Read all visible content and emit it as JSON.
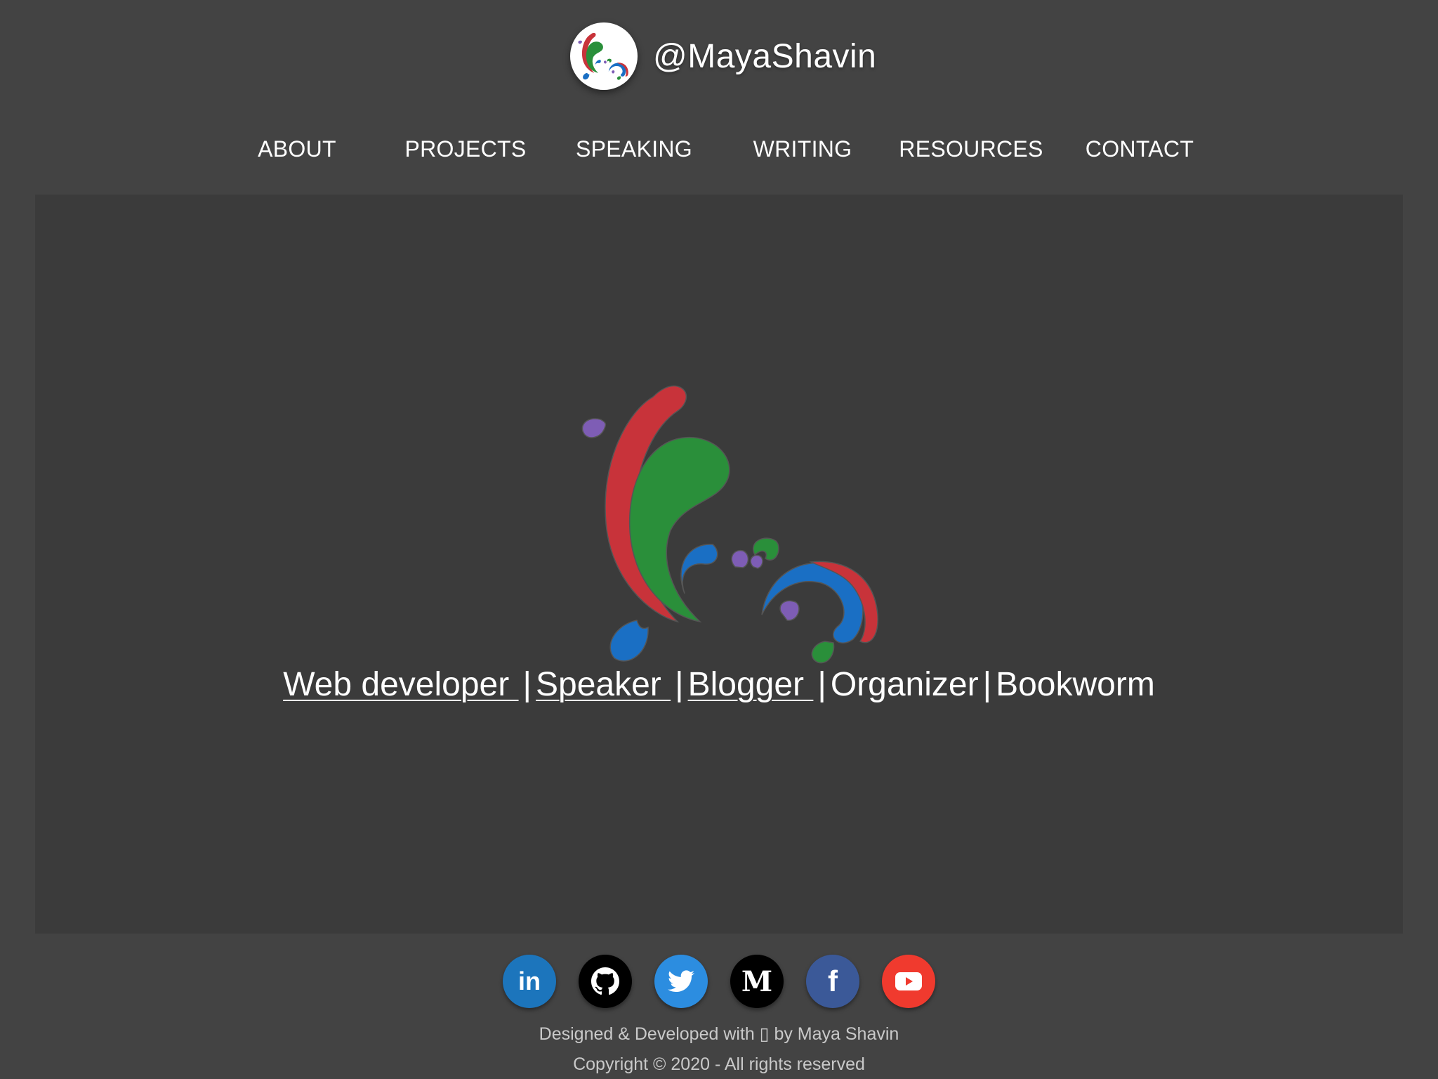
{
  "header": {
    "handle": "@MayaShavin"
  },
  "nav": {
    "items": [
      {
        "label": "About"
      },
      {
        "label": "Projects"
      },
      {
        "label": "Speaking"
      },
      {
        "label": "Writing"
      },
      {
        "label": "Resources"
      },
      {
        "label": "Contact"
      }
    ]
  },
  "hero": {
    "links": [
      {
        "label": "Web developer "
      },
      {
        "label": "Speaker "
      },
      {
        "label": "Blogger "
      }
    ],
    "separator": "|",
    "plain": [
      "Organizer",
      "Bookworm"
    ]
  },
  "social": {
    "items": [
      {
        "name": "linkedin-icon",
        "color": "#1c75bc",
        "glyph": "in"
      },
      {
        "name": "github-icon",
        "color": "#000000"
      },
      {
        "name": "twitter-icon",
        "color": "#2c8de0"
      },
      {
        "name": "medium-icon",
        "color": "#000000",
        "glyph": "M"
      },
      {
        "name": "facebook-icon",
        "color": "#3b5998",
        "glyph": "f"
      },
      {
        "name": "youtube-icon",
        "color": "#f03a2e"
      }
    ]
  },
  "footer": {
    "credit": "Designed & Developed with ▯ by Maya Shavin",
    "copyright": "Copyright © 2020 - All rights reserved"
  },
  "colors": {
    "background": "#434343",
    "hero_background": "#3b3b3b",
    "logo_red": "#c8333a",
    "logo_green": "#2a8f3a",
    "logo_blue": "#1a6fc4",
    "logo_purple": "#7e5db5"
  }
}
